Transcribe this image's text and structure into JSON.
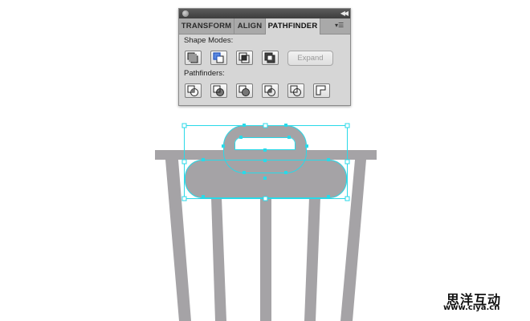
{
  "panel": {
    "tabs": [
      {
        "label": "TRANSFORM",
        "active": false
      },
      {
        "label": "ALIGN",
        "active": false
      },
      {
        "label": "PATHFINDER",
        "active": true
      }
    ],
    "shape_modes_label": "Shape Modes:",
    "pathfinders_label": "Pathfinders:",
    "expand_label": "Expand",
    "shape_mode_buttons": [
      "unite",
      "minus-front",
      "intersect",
      "exclude"
    ],
    "pathfinder_buttons": [
      "divide",
      "trim",
      "merge",
      "crop",
      "outline",
      "minus-back"
    ]
  },
  "artwork": {
    "fill_color": "#a5a3a6",
    "selection_color": "#29d9e8"
  },
  "watermark": {
    "title": "思洋互动",
    "url": "www.ciya.cn"
  }
}
